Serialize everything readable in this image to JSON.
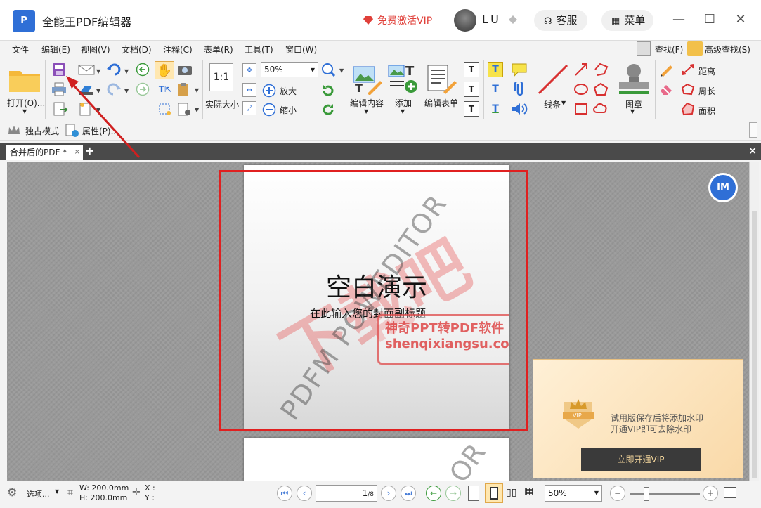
{
  "titlebar": {
    "logo": "P",
    "app_title": "全能王PDF编辑器",
    "vip_link": "免费激活VIP",
    "username": "LU",
    "service_label": "客服",
    "menu_label": "菜单"
  },
  "menubar": {
    "items": [
      "文件",
      "编辑(E)",
      "视图(V)",
      "文档(D)",
      "注释(C)",
      "表单(R)",
      "工具(T)",
      "窗口(W)"
    ],
    "find_label": "查找(F)",
    "advanced_find_label": "高级查找(S)"
  },
  "toolbar": {
    "open_label": "打开(O)...",
    "actual_size_label": "实际大小",
    "actual_size_icon_text": "1:1",
    "zoom_value": "50%",
    "zoom_in_label": "放大",
    "zoom_out_label": "缩小",
    "edit_content_label": "编辑内容",
    "add_label": "添加",
    "edit_form_label": "编辑表单",
    "lines_label": "线条",
    "stamp_label": "图章",
    "distance_label": "距离",
    "perimeter_label": "周长",
    "area_label": "面积"
  },
  "subbar": {
    "exclusive_mode_label": "独占模式",
    "properties_label": "属性(P)..."
  },
  "tabs": {
    "doc_tab_label": "合并后的PDF *",
    "doc_tab_close": "×",
    "add_tab": "+",
    "close_all": "×"
  },
  "document": {
    "slide_title": "空白演示",
    "slide_subtitle": "在此输入您的封面副标题",
    "watermark_cn": "下载吧",
    "watermark_diag": "PDFM POWEDITOR",
    "watermark_diag2": "OR",
    "stamp_line1": "神奇PPT转PDF软件",
    "stamp_line2": "shenqixiangsu.com"
  },
  "floating": {
    "fab_text": "IM"
  },
  "promo": {
    "message_line1": "试用版保存后将添加水印",
    "message_line2": "开通VIP即可去除水印",
    "cta_label": "立即开通VIP",
    "badge_text": "VIP"
  },
  "statusbar": {
    "options_label": "选项...",
    "width_label": "W: 200.0mm",
    "height_label": "H: 200.0mm",
    "x_label": "X :",
    "y_label": "Y :",
    "page_current": "1",
    "page_total": "/8",
    "zoom_value": "50%"
  }
}
